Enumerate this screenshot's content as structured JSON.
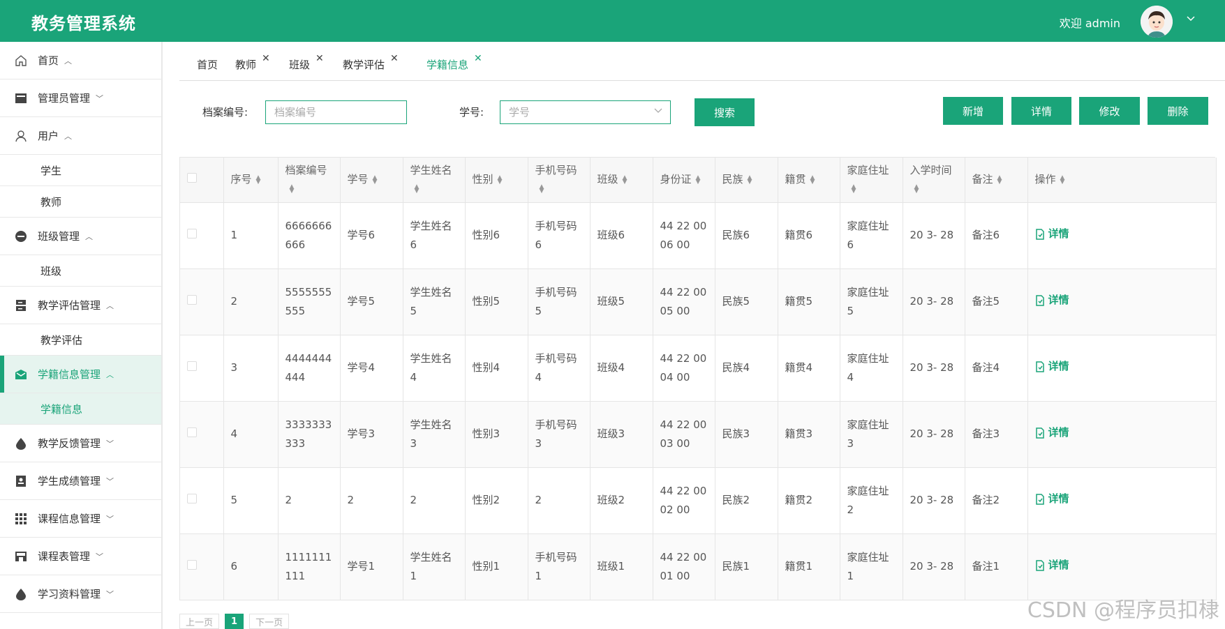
{
  "app": {
    "title": "教务管理系统",
    "welcome": "欢迎 admin"
  },
  "sidebar": {
    "items": [
      {
        "label": "首页",
        "icon": "home-icon",
        "chev": "^"
      },
      {
        "label": "管理员管理",
        "icon": "card-icon",
        "chev": "v"
      },
      {
        "label": "用户",
        "icon": "user-icon",
        "chev": "^"
      },
      {
        "label": "学生",
        "sub": true
      },
      {
        "label": "教师",
        "sub": true
      },
      {
        "label": "班级管理",
        "icon": "dash-circle-icon",
        "chev": "^"
      },
      {
        "label": "班级",
        "sub": true
      },
      {
        "label": "教学评估管理",
        "icon": "server-icon",
        "chev": "^"
      },
      {
        "label": "教学评估",
        "sub": true
      },
      {
        "label": "学籍信息管理",
        "icon": "mail-icon",
        "chev": "^"
      },
      {
        "label": "学籍信息",
        "sub": true
      },
      {
        "label": "教学反馈管理",
        "icon": "drop-icon",
        "chev": "v"
      },
      {
        "label": "学生成绩管理",
        "icon": "badge-icon",
        "chev": "v"
      },
      {
        "label": "课程信息管理",
        "icon": "grid-icon",
        "chev": "v"
      },
      {
        "label": "课程表管理",
        "icon": "store-icon",
        "chev": "v"
      },
      {
        "label": "学习资料管理",
        "icon": "drop-icon",
        "chev": "v"
      }
    ]
  },
  "tabs": [
    {
      "label": "首页"
    },
    {
      "label": "教师",
      "close": "✕"
    },
    {
      "label": "班级",
      "close": "✕"
    },
    {
      "label": "教学评估",
      "close": "✕"
    },
    {
      "label": "学籍信息",
      "close": "✕"
    }
  ],
  "search": {
    "file_label": "档案编号:",
    "file_placeholder": "档案编号",
    "sid_label": "学号:",
    "sid_placeholder": "学号",
    "search_btn": "搜索"
  },
  "actions": {
    "add": "新增",
    "detail": "详情",
    "edit": "修改",
    "delete": "删除"
  },
  "table": {
    "headers": [
      "序号",
      "档案编号",
      "学号",
      "学生姓名",
      "性别",
      "手机号码",
      "班级",
      "身份证",
      "民族",
      "籍贯",
      "家庭住址",
      "入学时间",
      "备注",
      "操作"
    ],
    "rows": [
      {
        "no": "1",
        "file": "6666666666",
        "sid": "学号6",
        "name": "学生姓名6",
        "gender": "性别6",
        "phone": "手机号码6",
        "cls": "班级6",
        "idcard": "44 22 00 06 00",
        "nation": "民族6",
        "origin": "籍贯6",
        "addr": "家庭住址6",
        "date": "20 3- 28",
        "note": "备注6",
        "op": "详情"
      },
      {
        "no": "2",
        "file": "5555555555",
        "sid": "学号5",
        "name": "学生姓名5",
        "gender": "性别5",
        "phone": "手机号码5",
        "cls": "班级5",
        "idcard": "44 22 00 05 00",
        "nation": "民族5",
        "origin": "籍贯5",
        "addr": "家庭住址5",
        "date": "20 3- 28",
        "note": "备注5",
        "op": "详情"
      },
      {
        "no": "3",
        "file": "4444444444",
        "sid": "学号4",
        "name": "学生姓名4",
        "gender": "性别4",
        "phone": "手机号码4",
        "cls": "班级4",
        "idcard": "44 22 00 04 00",
        "nation": "民族4",
        "origin": "籍贯4",
        "addr": "家庭住址4",
        "date": "20 3- 28",
        "note": "备注4",
        "op": "详情"
      },
      {
        "no": "4",
        "file": "3333333333",
        "sid": "学号3",
        "name": "学生姓名3",
        "gender": "性别3",
        "phone": "手机号码3",
        "cls": "班级3",
        "idcard": "44 22 00 03 00",
        "nation": "民族3",
        "origin": "籍贯3",
        "addr": "家庭住址3",
        "date": "20 3- 28",
        "note": "备注3",
        "op": "详情"
      },
      {
        "no": "5",
        "file": "2",
        "sid": "2",
        "name": "2",
        "gender": "性别2",
        "phone": "2",
        "cls": "班级2",
        "idcard": "44 22 00 02 00",
        "nation": "民族2",
        "origin": "籍贯2",
        "addr": "家庭住址2",
        "date": "20 3- 28",
        "note": "备注2",
        "op": "详情"
      },
      {
        "no": "6",
        "file": "1111111111",
        "sid": "学号1",
        "name": "学生姓名1",
        "gender": "性别1",
        "phone": "手机号码1",
        "cls": "班级1",
        "idcard": "44 22 00 01 00",
        "nation": "民族1",
        "origin": "籍贯1",
        "addr": "家庭住址1",
        "date": "20 3- 28",
        "note": "备注1",
        "op": "详情"
      }
    ]
  },
  "pager": {
    "prev": "上一页",
    "current": "1",
    "next": "下一页"
  },
  "watermark": "CSDN @程序员扣棣",
  "colors": {
    "primary": "#1aa479",
    "active_bg": "#e6f4ef"
  }
}
